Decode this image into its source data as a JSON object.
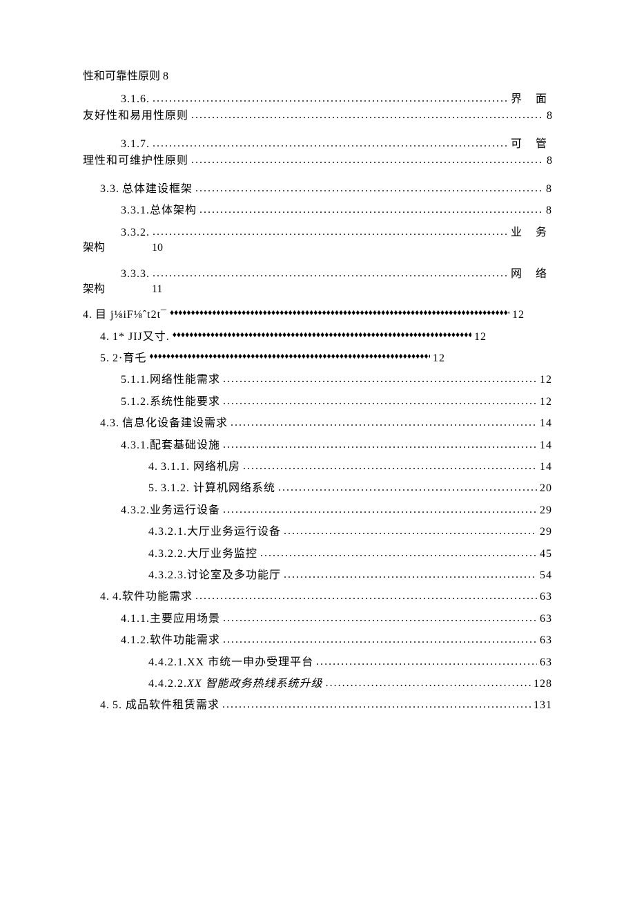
{
  "top_fragment": "性和可靠性原则 8",
  "w316": {
    "num": "3.1.6.",
    "tail": "界 面",
    "cont": "友好性和易用性原则",
    "page": "8"
  },
  "w317": {
    "num": "3.1.7.",
    "tail": "可 管",
    "cont": "理性和可维护性原则",
    "page": "8"
  },
  "e33": {
    "num": "3.3.",
    "label": "总体建设框架",
    "page": "8"
  },
  "e331": {
    "num": "3.3.1.",
    "label": "总体架构",
    "page": "8"
  },
  "s332": {
    "num": "3.3.2.",
    "tail": "业 务",
    "cont_col1": "架构",
    "cont_col2": "10"
  },
  "s333": {
    "num": "3.3.3.",
    "tail": "网 络",
    "cont_col1": "架构",
    "cont_col2": "11"
  },
  "d4": {
    "num": "4.",
    "label": "目 j⅛iF⅛ˆt2t¯",
    "page": "12"
  },
  "d41": {
    "num": "4.",
    "label": "1* JIJ又寸.",
    "page": "12"
  },
  "d52": {
    "num": "5.",
    "label": "2·育乇",
    "page": "12"
  },
  "e511": {
    "num": "5.1.1.",
    "label": "网络性能需求",
    "page": "12"
  },
  "e512": {
    "num": "5.1.2.",
    "label": "系统性能要求",
    "page": "12"
  },
  "e43": {
    "num": "4.3.",
    "label": "信息化设备建设需求",
    "page": "14"
  },
  "e431": {
    "num": "4.3.1.",
    "label": "配套基础设施",
    "page": "14"
  },
  "e4311": {
    "num": "4.",
    "label": "3.1.1. 网络机房",
    "page": "14"
  },
  "e4312": {
    "num": "5.",
    "label": "3.1.2. 计算机网络系统",
    "page": "20"
  },
  "e432": {
    "num": "4.3.2.",
    "label": "业务运行设备",
    "page": "29"
  },
  "e4321": {
    "num": "4.3.2.1.",
    "label": "大厅业务运行设备",
    "page": "29"
  },
  "e4322": {
    "num": "4.3.2.2.",
    "label": "大厅业务监控",
    "page": "45"
  },
  "e4323": {
    "num": "4.3.2.3.",
    "label": "讨论室及多功能厅",
    "page": "54"
  },
  "e44": {
    "num": "4.",
    "label": "4.软件功能需求",
    "page": "63"
  },
  "e411": {
    "num": "4.1.1.",
    "label": "主要应用场景",
    "page": "63"
  },
  "e412": {
    "num": "4.1.2.",
    "label": "软件功能需求",
    "page": "63"
  },
  "e4421": {
    "num": "4.4.2.1.",
    "label": "XX 市统一申办受理平台",
    "page": "63"
  },
  "e4422": {
    "num": "4.4.2.2.",
    "label": "XX 智能政务热线系统升级",
    "page": "128"
  },
  "e45": {
    "num": "4.",
    "label": "5. 成品软件租赁需求",
    "page": "131"
  }
}
